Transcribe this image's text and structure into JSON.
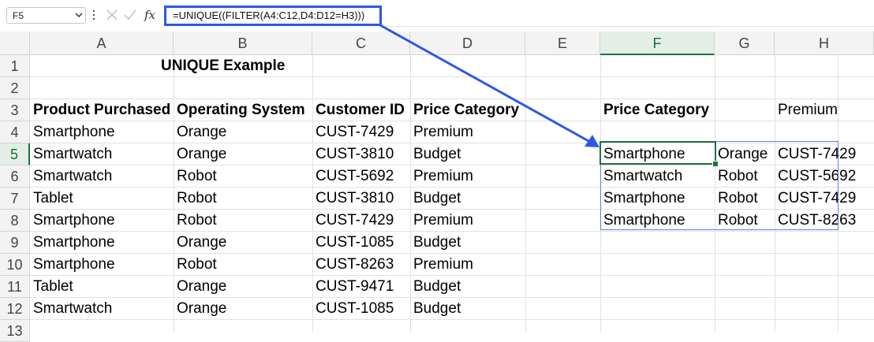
{
  "name_box": "F5",
  "formula": "=UNIQUE((FILTER(A4:C12,D4:D12=H3)))",
  "fx_label": "fx",
  "columns": [
    "A",
    "B",
    "C",
    "D",
    "E",
    "F",
    "G",
    "H"
  ],
  "rows": [
    "1",
    "2",
    "3",
    "4",
    "5",
    "6",
    "7",
    "8",
    "9",
    "10",
    "11",
    "12",
    "13"
  ],
  "cells": {
    "title": "UNIQUE Example",
    "headers": [
      "Product Purchased",
      "Operating System",
      "Customer ID",
      "Price Category"
    ],
    "data": [
      [
        "Smartphone",
        "Orange",
        "CUST-7429",
        "Premium"
      ],
      [
        "Smartwatch",
        "Orange",
        "CUST-3810",
        "Budget"
      ],
      [
        "Smartwatch",
        "Robot",
        "CUST-5692",
        "Premium"
      ],
      [
        "Tablet",
        "Robot",
        "CUST-3810",
        "Budget"
      ],
      [
        "Smartphone",
        "Robot",
        "CUST-7429",
        "Premium"
      ],
      [
        "Smartphone",
        "Orange",
        "CUST-1085",
        "Budget"
      ],
      [
        "Smartphone",
        "Robot",
        "CUST-8263",
        "Premium"
      ],
      [
        "Tablet",
        "Orange",
        "CUST-9471",
        "Budget"
      ],
      [
        "Smartwatch",
        "Orange",
        "CUST-1085",
        "Budget"
      ]
    ],
    "criteria_label": "Price Category",
    "criteria_value": "Premium",
    "result": [
      [
        "Smartphone",
        "Orange",
        "CUST-7429"
      ],
      [
        "Smartwatch",
        "Robot",
        "CUST-5692"
      ],
      [
        "Smartphone",
        "Robot",
        "CUST-7429"
      ],
      [
        "Smartphone",
        "Robot",
        "CUST-8263"
      ]
    ]
  },
  "colors": {
    "highlight_blue": "#2b58e8",
    "selection_green": "#1e7145",
    "spill_border": "#5b82e0"
  }
}
